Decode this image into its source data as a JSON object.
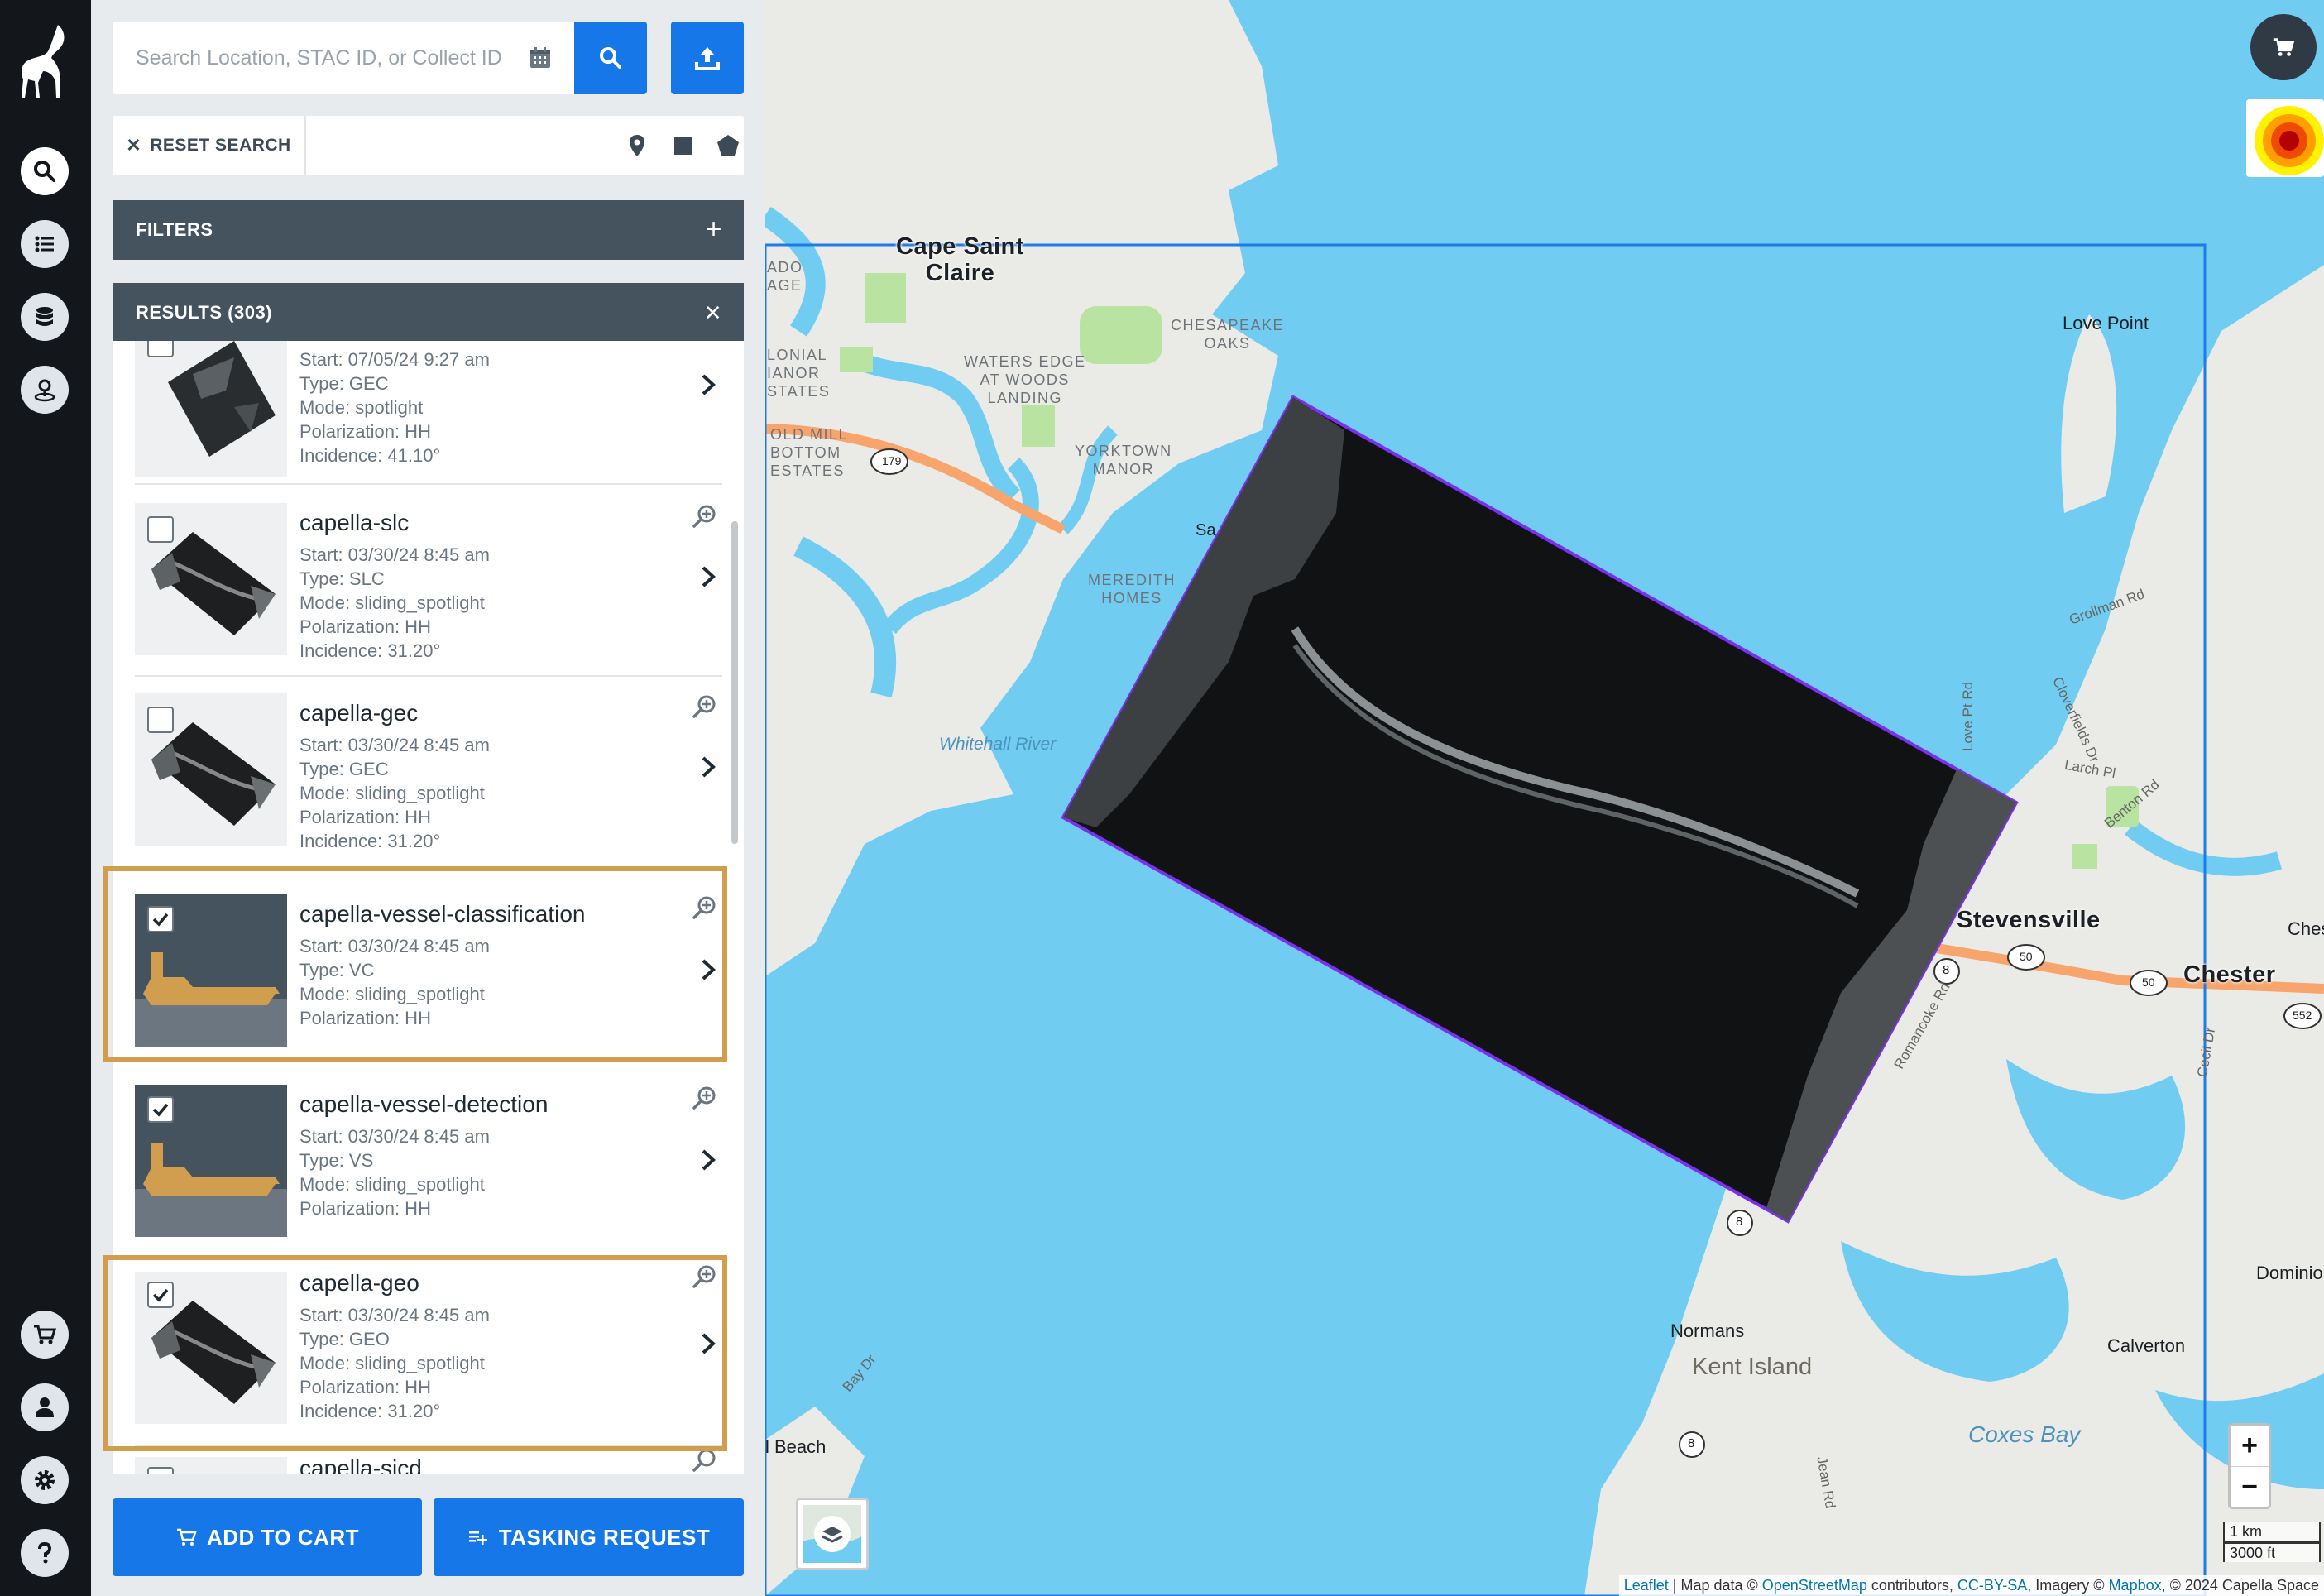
{
  "search": {
    "placeholder": "Search Location, STAC ID, or Collect ID"
  },
  "toolbar": {
    "reset_label": "RESET SEARCH",
    "reset_icon": "close-icon"
  },
  "filters": {
    "label": "FILTERS",
    "action_icon": "plus-icon"
  },
  "results": {
    "label": "RESULTS (303)",
    "action_icon": "close-icon",
    "items": [
      {
        "title": "",
        "start": "Start: 07/05/24 9:27 am",
        "type": "Type: GEC",
        "mode": "Mode: spotlight",
        "polarization": "Polarization: HH",
        "incidence": "Incidence: 41.10°",
        "checked": false,
        "thumb": "sar"
      },
      {
        "title": "capella-slc",
        "start": "Start: 03/30/24 8:45 am",
        "type": "Type: SLC",
        "mode": "Mode: sliding_spotlight",
        "polarization": "Polarization: HH",
        "incidence": "Incidence: 31.20°",
        "checked": false,
        "thumb": "sar"
      },
      {
        "title": "capella-gec",
        "start": "Start: 03/30/24 8:45 am",
        "type": "Type: GEC",
        "mode": "Mode: sliding_spotlight",
        "polarization": "Polarization: HH",
        "incidence": "Incidence: 31.20°",
        "checked": false,
        "thumb": "sar"
      },
      {
        "title": "capella-vessel-classification",
        "start": "Start: 03/30/24 8:45 am",
        "type": "Type: VC",
        "mode": "Mode: sliding_spotlight",
        "polarization": "Polarization: HH",
        "checked": true,
        "highlighted": true,
        "thumb": "vessel"
      },
      {
        "title": "capella-vessel-detection",
        "start": "Start: 03/30/24 8:45 am",
        "type": "Type: VS",
        "mode": "Mode: sliding_spotlight",
        "polarization": "Polarization: HH",
        "checked": true,
        "thumb": "vessel"
      },
      {
        "title": "capella-geo",
        "start": "Start: 03/30/24 8:45 am",
        "type": "Type: GEO",
        "mode": "Mode: sliding_spotlight",
        "polarization": "Polarization: HH",
        "incidence": "Incidence: 31.20°",
        "checked": true,
        "highlighted": true,
        "thumb": "sar"
      },
      {
        "title": "capella-sicd",
        "checked": false,
        "thumb": "sar"
      }
    ]
  },
  "actions": {
    "add_to_cart": "ADD TO CART",
    "tasking_request": "TASKING REQUEST"
  },
  "rail": {
    "top_icons": [
      "search-icon",
      "list-icon",
      "database-icon",
      "location-icon"
    ],
    "bottom_icons": [
      "cart-icon",
      "user-icon",
      "gear-icon",
      "help-icon"
    ]
  },
  "map": {
    "labels": {
      "cape_saint_claire": "Cape Saint\nClaire",
      "chesapeake_oaks": "CHESAPEAKE\nOAKS",
      "waters_edge": "WATERS EDGE\nAT WOODS\nLANDING",
      "colonial_manor": "LONIAL\nIANOR\nSTATES",
      "ado_age": "ADO\nAGE",
      "old_mill": "OLD MILL\nBOTTOM\nESTATES",
      "yorktown_manor": "YORKTOWN\nMANOR",
      "meredith_homes": "MEREDITH\nHOMES",
      "whitehall_river": "Whitehall River",
      "love_point": "Love Point",
      "stevensville": "Stevensville",
      "chester": "Chester",
      "ches": "Ches",
      "dominion": "Dominio",
      "calverton": "Calverton",
      "normans": "Normans",
      "kent_island": "Kent Island",
      "coxes_bay": "Coxes Bay",
      "beach": "l Beach",
      "sa": "Sa",
      "grollman_rd": "Grollman Rd",
      "cloverfields_dr": "Cloverfields Dr",
      "larch_pl": "Larch Pl",
      "benton_rd": "Benton Rd",
      "love_point_rd": "Love Pt Rd",
      "jean_rd": "Jean Rd",
      "bay_dr": "Bay Dr",
      "cecil_dr": "Cecil Dr",
      "romancoke_rd": "Romancoke Rd",
      "route_179": "179",
      "route_50": "50",
      "route_8": "8",
      "route_552": "552"
    },
    "zoom_in": "+",
    "zoom_out": "−",
    "scale_km": "1 km",
    "scale_ft": "3000 ft",
    "attribution": {
      "leaflet": "Leaflet",
      "map_data": " | Map data © ",
      "osm": "OpenStreetMap",
      "contributors": " contributors, ",
      "license": "CC-BY-SA",
      "imagery": ", Imagery © ",
      "mapbox": "Mapbox",
      "tail": ", © 2024 Capella Space"
    },
    "colors": {
      "water": "#70cdf1",
      "land": "#eaeae6",
      "footprint": "#7b2ff0",
      "aoi": "#1f7be8"
    }
  },
  "colors": {
    "accent_blue": "#1677e8",
    "highlight_gold": "#d19d4f",
    "rail_bg": "#13161a",
    "section_bar": "#45535f"
  }
}
